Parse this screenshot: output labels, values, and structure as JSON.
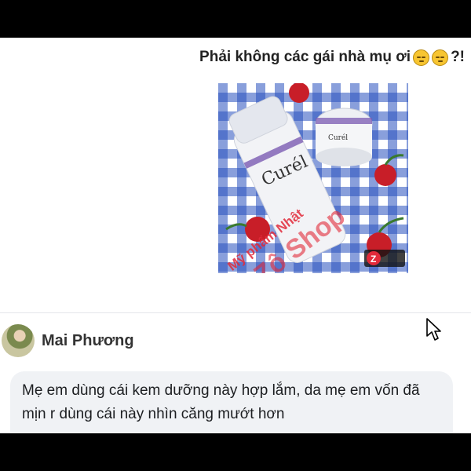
{
  "post": {
    "text": "Phải không các gái nhà mụ ơi",
    "suffix": "?!",
    "emojis": [
      "pensive-face-emoji",
      "pensive-face-emoji"
    ]
  },
  "photo": {
    "product_brand": "Curél",
    "watermark_line1": "Mỹ phẩm Nhật",
    "watermark_line2": "Zô Shop",
    "badge": "Z",
    "colors": {
      "gingham": "#2850be",
      "cherry": "#c81e28",
      "bottle": "#f2f3f6",
      "accent": "#7b5bb3",
      "watermark": "#e22a3a"
    }
  },
  "comment": {
    "author": "Mai Phương",
    "text": "Mẹ em dùng cái kem dưỡng này hợp lắm, da mẹ em vốn đã mịn r dùng cái này nhìn căng mướt hơn"
  },
  "icons": {
    "cursor": "mouse-pointer-icon"
  }
}
